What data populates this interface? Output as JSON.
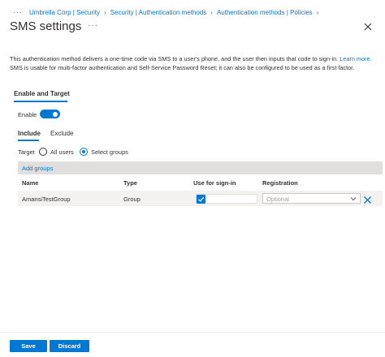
{
  "breadcrumb": {
    "more": "···",
    "items": [
      "Umbrella Corp | Security",
      "Security | Authentication methods",
      "Authentication methods | Policies"
    ]
  },
  "header": {
    "title": "SMS settings",
    "more": "···"
  },
  "description": {
    "line1": "This authentication method delivers a one-time code via SMS to a user's phone, and the user then inputs that code to sign-in.",
    "learn_more": "Learn more.",
    "line2": "SMS is usable for multi-factor authentication and Self-Service Password Reset; it can also be configured to be used as a first factor."
  },
  "section": {
    "title": "Enable and Target",
    "enable_label": "Enable",
    "enabled": true
  },
  "tabs": {
    "include": "Include",
    "exclude": "Exclude"
  },
  "target": {
    "label": "Target",
    "all_users": "All users",
    "select_groups": "Select groups",
    "selected": "select_groups"
  },
  "add_groups": "Add groups",
  "table": {
    "headers": [
      "Name",
      "Type",
      "Use for sign-in",
      "Registration"
    ],
    "rows": [
      {
        "name": "AmansiTestGroup",
        "type": "Group",
        "use_for_sign_in": true,
        "registration_placeholder": "Optional"
      }
    ]
  },
  "footer": {
    "save": "Save",
    "discard": "Discard"
  },
  "colors": {
    "accent": "#0078d4",
    "bar": "#e1dfdd",
    "row": "#f3f2f1"
  }
}
